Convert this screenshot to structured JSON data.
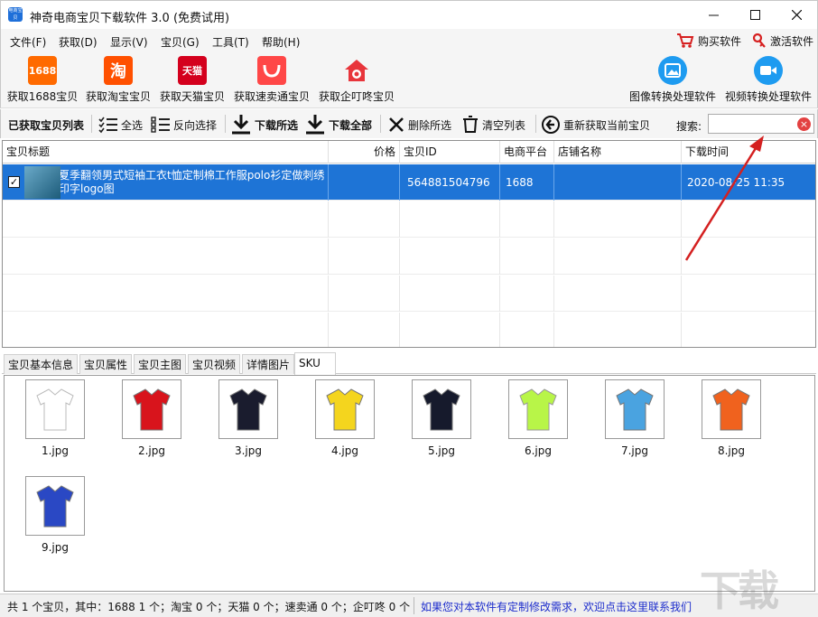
{
  "window": {
    "title": "神奇电商宝贝下载软件 3.0 (免费试用)",
    "app_icon_text": "电商宝贝"
  },
  "menu": {
    "items": [
      "文件(F)",
      "获取(D)",
      "显示(V)",
      "宝贝(G)",
      "工具(T)",
      "帮助(H)"
    ],
    "buy": "购买软件",
    "activate": "激活软件"
  },
  "toolbar_main": {
    "buttons": [
      {
        "label": "获取1688宝贝",
        "icon_text": "1688",
        "color": "#ff6a00"
      },
      {
        "label": "获取淘宝宝贝",
        "icon_text": "淘",
        "color": "#ff5000"
      },
      {
        "label": "获取天猫宝贝",
        "icon_text": "天猫",
        "color": "#d4001d"
      },
      {
        "label": "获取速卖通宝贝",
        "icon_text": "",
        "color": "#ff4747"
      },
      {
        "label": "获取企叮咚宝贝",
        "icon_text": "",
        "color": "#e8353b"
      }
    ],
    "right_buttons": [
      {
        "label": "图像转换处理软件",
        "color": "#1e9bf0"
      },
      {
        "label": "视频转换处理软件",
        "color": "#1e9bf0"
      }
    ]
  },
  "toolbar_list": {
    "title": "已获取宝贝列表",
    "select_all": "全选",
    "invert_select": "反向选择",
    "download_selected": "下载所选",
    "download_all": "下载全部",
    "delete_selected": "删除所选",
    "clear_list": "清空列表",
    "refetch": "重新获取当前宝贝",
    "search_label": "搜索:",
    "search_value": ""
  },
  "table": {
    "columns": [
      "宝贝标题",
      "价格",
      "宝贝ID",
      "电商平台",
      "店铺名称",
      "下载时间"
    ],
    "rows": [
      {
        "checked": true,
        "title": "夏季翻领男式短袖工衣t恤定制棉工作服polo衫定做刺绣印字logo图",
        "price": "",
        "id": "564881504796",
        "platform": "1688",
        "shop": "",
        "time": "2020-08-25 11:35"
      }
    ]
  },
  "tabs": {
    "items": [
      "宝贝基本信息",
      "宝贝属性",
      "宝贝主图",
      "宝贝视频",
      "详情图片",
      "SKU"
    ],
    "active": "SKU"
  },
  "sku_images": [
    {
      "name": "1.jpg",
      "color": "#ffffff"
    },
    {
      "name": "2.jpg",
      "color": "#d8141c"
    },
    {
      "name": "3.jpg",
      "color": "#1a1c2e"
    },
    {
      "name": "4.jpg",
      "color": "#f4d51e"
    },
    {
      "name": "5.jpg",
      "color": "#161a2c"
    },
    {
      "name": "6.jpg",
      "color": "#b8f548"
    },
    {
      "name": "7.jpg",
      "color": "#4aa3e0"
    },
    {
      "name": "8.jpg",
      "color": "#f0621e"
    },
    {
      "name": "9.jpg",
      "color": "#2a48c4"
    }
  ],
  "status": {
    "summary": "共 1 个宝贝，其中：1688 1 个；淘宝 0 个；天猫 0 个；速卖通 0 个；企叮咚 0 个",
    "link": "如果您对本软件有定制修改需求，欢迎点击这里联系我们"
  },
  "watermark": "下载吧",
  "colors": {
    "selection": "#1e74d6",
    "link": "#1c2ccc",
    "arrow": "#d42020"
  }
}
